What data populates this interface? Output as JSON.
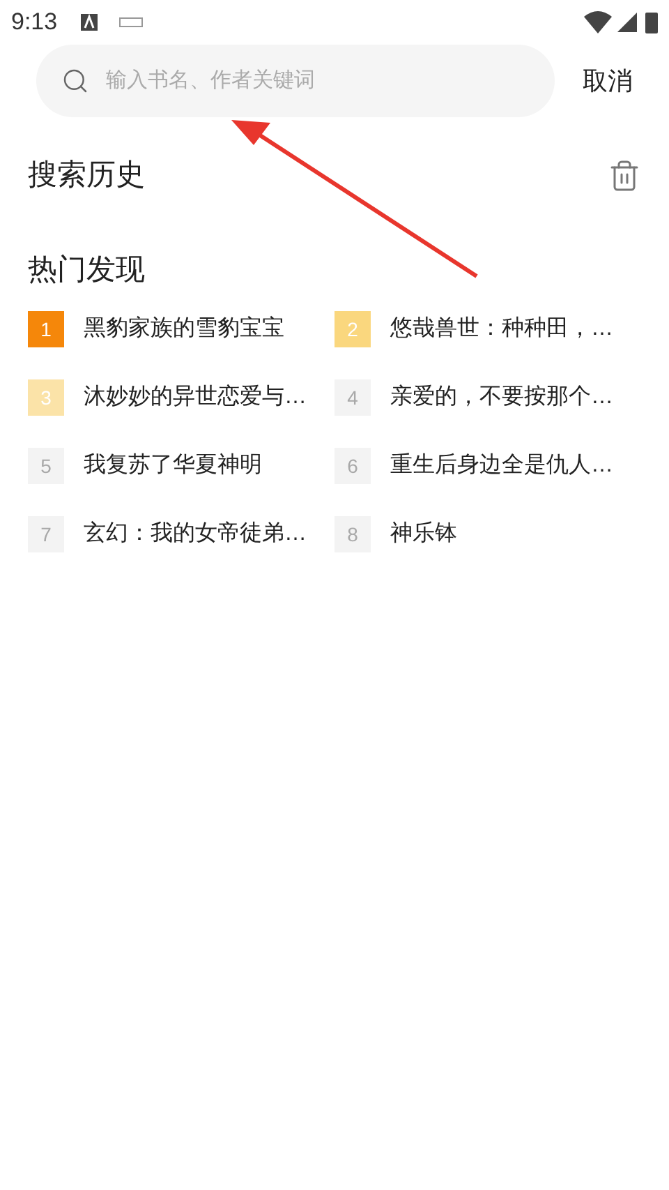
{
  "status_bar": {
    "time": "9:13"
  },
  "search": {
    "placeholder": "输入书名、作者关键词",
    "cancel": "取消"
  },
  "history": {
    "title": "搜索历史"
  },
  "hot": {
    "title": "热门发现",
    "items": [
      {
        "rank": "1",
        "title": "黑豹家族的雪豹宝宝",
        "color": "#f5870a"
      },
      {
        "rank": "2",
        "title": "悠哉兽世：种种田，…",
        "color": "#fad77e"
      },
      {
        "rank": "3",
        "title": "沐妙妙的异世恋爱与…",
        "color": "#fbe3a8"
      },
      {
        "rank": "4",
        "title": "亲爱的，不要按那个…",
        "color": "#f3f3f3"
      },
      {
        "rank": "5",
        "title": "我复苏了华夏神明",
        "color": "#f3f3f3"
      },
      {
        "rank": "6",
        "title": "重生后身边全是仇人…",
        "color": "#f3f3f3"
      },
      {
        "rank": "7",
        "title": "玄幻：我的女帝徒弟…",
        "color": "#f3f3f3"
      },
      {
        "rank": "8",
        "title": "神乐钵",
        "color": "#f3f3f3"
      }
    ]
  }
}
